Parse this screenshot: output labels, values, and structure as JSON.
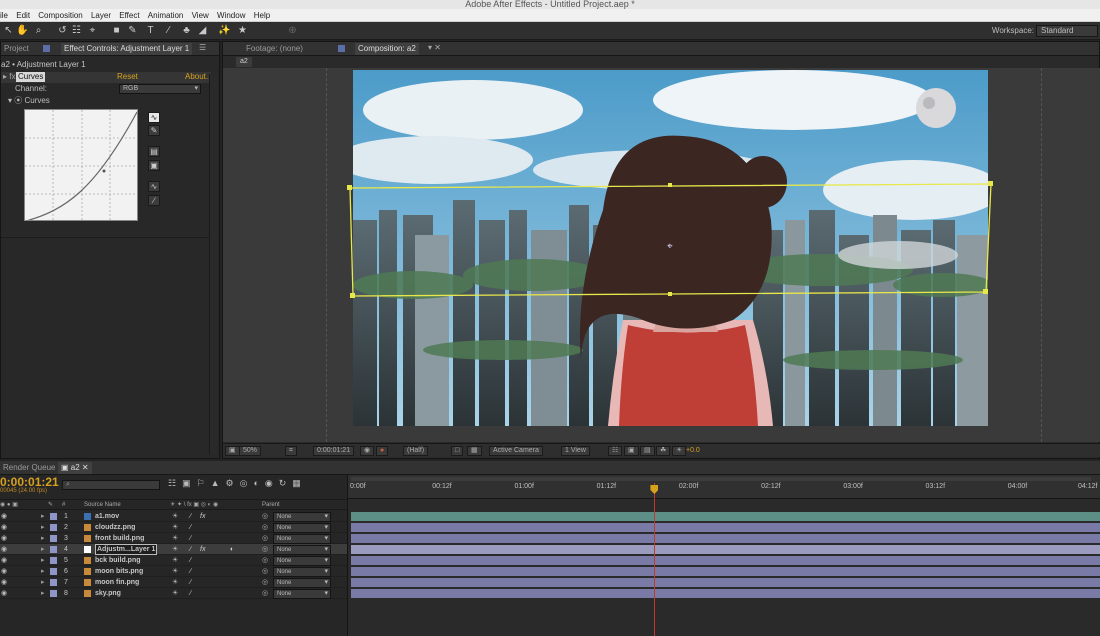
{
  "app": {
    "title": "Adobe After Effects - Untitled Project.aep *",
    "menu": [
      "ile",
      "Edit",
      "Composition",
      "Layer",
      "Effect",
      "Animation",
      "View",
      "Window",
      "Help"
    ],
    "workspace_label": "Workspace:",
    "workspace_value": "Standard"
  },
  "left_panel": {
    "tab_project": "Project",
    "tab_effect_controls": "Effect Controls: Adjustment Layer 1",
    "breadcrumb": "a2 • Adjustment Layer 1",
    "effect_name": "Curves",
    "reset_label": "Reset",
    "about_label": "About...",
    "channel_label": "Channel:",
    "channel_value": "RGB",
    "curves_prop": "Curves"
  },
  "viewer": {
    "tab_footage": "Footage: (none)",
    "tab_composition": "Composition: a2",
    "comp_chip": "a2",
    "zoom": "50%",
    "timecode": "0:00:01:21",
    "resolution": "(Half)",
    "camera": "Active Camera",
    "view_count": "1 View",
    "exposure": "+0.0"
  },
  "timeline": {
    "tab_render_queue": "Render Queue",
    "tab_comp": "a2",
    "timecode": "0:00:01:21",
    "frames_fps": "00045 (24.00 fps)",
    "search_placeholder": "⌕",
    "header_hash": "#",
    "header_source": "Source Name",
    "header_parent": "Parent",
    "ruler": [
      "0:00f",
      "00:12f",
      "01:00f",
      "01:12f",
      "02:00f",
      "02:12f",
      "03:00f",
      "03:12f",
      "04:00f",
      "04:12f"
    ],
    "current_time_fraction": 0.41,
    "layers": [
      {
        "num": "1",
        "name": "a1.mov",
        "parent": "None",
        "color": "#3a6fb0",
        "fx": true,
        "selected": false
      },
      {
        "num": "2",
        "name": "cloudzz.png",
        "parent": "None",
        "color": "#c9893a",
        "fx": false,
        "selected": false
      },
      {
        "num": "3",
        "name": "front build.png",
        "parent": "None",
        "color": "#c9893a",
        "fx": false,
        "selected": false
      },
      {
        "num": "4",
        "name": "Adjustm...Layer 1",
        "parent": "None",
        "color": "#ffffff",
        "fx": true,
        "selected": true
      },
      {
        "num": "5",
        "name": "bck build.png",
        "parent": "None",
        "color": "#c9893a",
        "fx": false,
        "selected": false
      },
      {
        "num": "6",
        "name": "moon bits.png",
        "parent": "None",
        "color": "#c9893a",
        "fx": false,
        "selected": false
      },
      {
        "num": "7",
        "name": "moon fin.png",
        "parent": "None",
        "color": "#c9893a",
        "fx": false,
        "selected": false
      },
      {
        "num": "8",
        "name": "sky.png",
        "parent": "None",
        "color": "#c9893a",
        "fx": false,
        "selected": false
      }
    ]
  },
  "colors": {
    "accent": "#d6a21e",
    "playhead": "#c0392b",
    "selection": "#e8e84a",
    "bar_teal": "#5e8f87",
    "bar_lav": "#7a7aa6"
  }
}
